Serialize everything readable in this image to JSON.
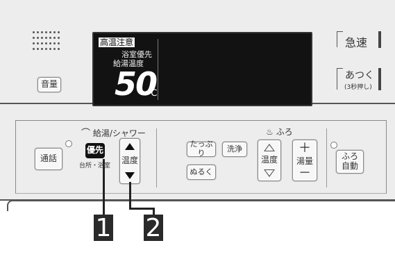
{
  "top_panel": {
    "volume_label": "音量",
    "display": {
      "warning": "高温注意",
      "line1": "浴室優先",
      "line2": "給湯温度",
      "temperature": "50",
      "unit": "℃"
    },
    "quick_button_label": "急速",
    "hot_button_label": "あつく",
    "hot_button_sub": "(3秒押し)"
  },
  "bottom_panel": {
    "call_button_label": "通話",
    "supply_section_label": "給湯/シャワー",
    "priority_button_label": "優先",
    "priority_sub_label": "台所・浴室",
    "temp_button_label": "温度",
    "bath_section_label": "ふろ",
    "plenty_button_label": "たっぷり",
    "wash_button_label": "洗浄",
    "lukewarm_button_label": "ぬるく",
    "bath_temp_label": "温度",
    "bath_volume_label": "湯量",
    "bath_auto_label_1": "ふろ",
    "bath_auto_label_2": "自動"
  },
  "callouts": {
    "first": "1",
    "second": "2"
  }
}
